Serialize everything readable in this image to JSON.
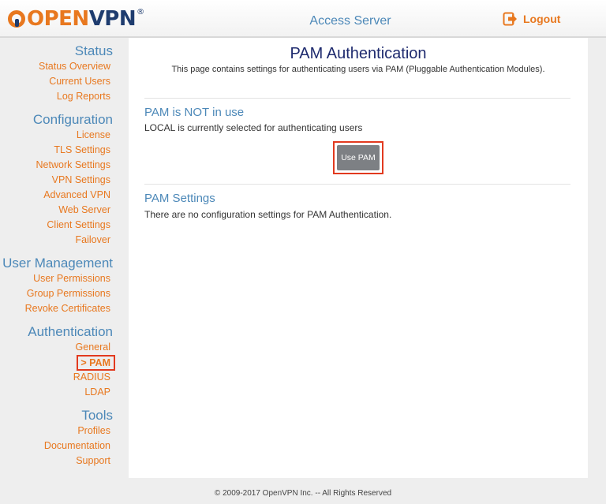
{
  "header": {
    "logo_open": "OPEN",
    "logo_vpn": "VPN",
    "logo_reg": "®",
    "app_title": "Access Server",
    "logout_label": "Logout"
  },
  "sidebar": {
    "status": {
      "heading": "Status",
      "items": [
        "Status Overview",
        "Current Users",
        "Log Reports"
      ]
    },
    "configuration": {
      "heading": "Configuration",
      "items": [
        "License",
        "TLS Settings",
        "Network Settings",
        "VPN Settings",
        "Advanced VPN",
        "Web Server",
        "Client Settings",
        "Failover"
      ]
    },
    "user_management": {
      "heading": "User Management",
      "items": [
        "User Permissions",
        "Group Permissions",
        "Revoke Certificates"
      ]
    },
    "authentication": {
      "heading": "Authentication",
      "items": [
        "General",
        "> PAM",
        "RADIUS",
        "LDAP"
      ]
    },
    "tools": {
      "heading": "Tools",
      "items": [
        "Profiles",
        "Documentation",
        "Support"
      ]
    }
  },
  "main": {
    "title": "PAM Authentication",
    "description": "This page contains settings for authenticating users via PAM (Pluggable Authentication Modules).",
    "status_heading": "PAM is NOT in use",
    "status_text": "LOCAL is currently selected for authenticating users",
    "use_button": "Use PAM",
    "settings_heading": "PAM Settings",
    "settings_text": "There are no configuration settings for PAM Authentication."
  },
  "footer": {
    "copyright": "© 2009-2017 OpenVPN Inc. -- All Rights Reserved"
  },
  "colors": {
    "accent_orange": "#e8781f",
    "heading_blue": "#4c88b8",
    "title_navy": "#1e2a6e",
    "highlight_red": "#e23a1f"
  }
}
